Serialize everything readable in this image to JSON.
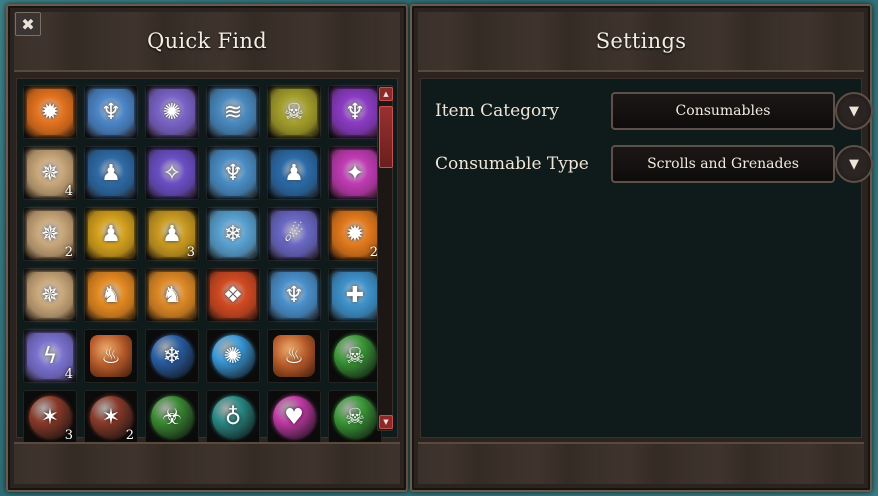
{
  "quick_find": {
    "title": "Quick Find",
    "close_label": "✖",
    "items": [
      {
        "name": "fire-scroll-icon",
        "kind": "scroll",
        "color": "#e5731f",
        "glyph": "✹",
        "count": ""
      },
      {
        "name": "air-scroll-icon",
        "kind": "scroll",
        "color": "#4c86c9",
        "glyph": "♆",
        "count": ""
      },
      {
        "name": "arcane-scroll-icon",
        "kind": "scroll",
        "color": "#7a64c8",
        "glyph": "✺",
        "count": ""
      },
      {
        "name": "rain-scroll-icon",
        "kind": "scroll",
        "color": "#4a8ac0",
        "glyph": "≋",
        "count": ""
      },
      {
        "name": "poison-scroll-icon",
        "kind": "scroll",
        "color": "#a5a02c",
        "glyph": "☠",
        "count": ""
      },
      {
        "name": "shadow-scroll-icon",
        "kind": "scroll",
        "color": "#8c3cc4",
        "glyph": "♆",
        "count": ""
      },
      {
        "name": "blank-scroll-icon",
        "kind": "scroll",
        "color": "#c9a77a",
        "glyph": "✵",
        "count": "4"
      },
      {
        "name": "resist-scroll-icon",
        "kind": "scroll",
        "color": "#2f6aa6",
        "glyph": "♟",
        "count": ""
      },
      {
        "name": "fall-scroll-icon",
        "kind": "scroll",
        "color": "#6a4fc4",
        "glyph": "✧",
        "count": ""
      },
      {
        "name": "levitate-scroll-icon",
        "kind": "scroll",
        "color": "#4a8dc6",
        "glyph": "♆",
        "count": ""
      },
      {
        "name": "ward-scroll-icon",
        "kind": "scroll",
        "color": "#2c6ba8",
        "glyph": "♟",
        "count": ""
      },
      {
        "name": "raven-scroll-icon",
        "kind": "scroll",
        "color": "#c03cb4",
        "glyph": "✦",
        "count": ""
      },
      {
        "name": "blank-scroll-icon",
        "kind": "scroll",
        "color": "#c9a77a",
        "glyph": "✵",
        "count": "2"
      },
      {
        "name": "bless-scroll-icon",
        "kind": "scroll",
        "color": "#d6a21e",
        "glyph": "♟",
        "count": ""
      },
      {
        "name": "strength-scroll-icon",
        "kind": "scroll",
        "color": "#cc9c22",
        "glyph": "♟",
        "count": "3"
      },
      {
        "name": "ice-scroll-icon",
        "kind": "scroll",
        "color": "#5aa2d2",
        "glyph": "❄",
        "count": ""
      },
      {
        "name": "ghost-scroll-icon",
        "kind": "scroll",
        "color": "#6a68c4",
        "glyph": "☄",
        "count": ""
      },
      {
        "name": "fireball-scroll-icon",
        "kind": "scroll",
        "color": "#e47a1c",
        "glyph": "✹",
        "count": "2"
      },
      {
        "name": "blank-scroll-icon",
        "kind": "scroll",
        "color": "#c9a77a",
        "glyph": "✵",
        "count": ""
      },
      {
        "name": "haste-scroll-icon",
        "kind": "scroll",
        "color": "#e58a22",
        "glyph": "♞",
        "count": ""
      },
      {
        "name": "sprint-scroll-icon",
        "kind": "scroll",
        "color": "#e08a26",
        "glyph": "♞",
        "count": ""
      },
      {
        "name": "armor-scroll-icon",
        "kind": "scroll",
        "color": "#d24a22",
        "glyph": "❖",
        "count": ""
      },
      {
        "name": "teleport-scroll-icon",
        "kind": "scroll",
        "color": "#4a90cc",
        "glyph": "♆",
        "count": ""
      },
      {
        "name": "heal-scroll-icon",
        "kind": "scroll",
        "color": "#3f92cc",
        "glyph": "✚",
        "count": ""
      },
      {
        "name": "lightning-scroll-icon",
        "kind": "scroll",
        "color": "#7a72d0",
        "glyph": "ϟ",
        "count": "4"
      },
      {
        "name": "fire-bottle-icon",
        "kind": "bottle",
        "color": "#b65a2a",
        "glyph": "♨",
        "count": ""
      },
      {
        "name": "frost-grenade-icon",
        "kind": "potion",
        "color": "#2a5fa6",
        "glyph": "❄",
        "count": ""
      },
      {
        "name": "water-flask-icon",
        "kind": "potion",
        "color": "#3a9adc",
        "glyph": "✺",
        "count": ""
      },
      {
        "name": "fire-bottle-icon",
        "kind": "bottle",
        "color": "#b65a2a",
        "glyph": "♨",
        "count": ""
      },
      {
        "name": "poison-flask-icon",
        "kind": "potion",
        "color": "#3b9a38",
        "glyph": "☠",
        "count": ""
      },
      {
        "name": "nail-bomb-icon",
        "kind": "potion",
        "color": "#8a3a2a",
        "glyph": "✶",
        "count": "3"
      },
      {
        "name": "nail-bomb-icon",
        "kind": "potion",
        "color": "#8a3a2a",
        "glyph": "✶",
        "count": "2"
      },
      {
        "name": "green-flask-icon",
        "kind": "potion",
        "color": "#3b8a34",
        "glyph": "☣",
        "count": ""
      },
      {
        "name": "water-blessed-flask-icon",
        "kind": "potion",
        "color": "#2a8a86",
        "glyph": "♁",
        "count": ""
      },
      {
        "name": "love-potion-icon",
        "kind": "potion",
        "color": "#c23aa6",
        "glyph": "♥",
        "count": ""
      },
      {
        "name": "poison-flask-icon",
        "kind": "potion",
        "color": "#3b9a38",
        "glyph": "☠",
        "count": ""
      }
    ]
  },
  "settings": {
    "title": "Settings",
    "rows": [
      {
        "label": "Item Category",
        "value": "Consumables"
      },
      {
        "label": "Consumable Type",
        "value": "Scrolls and Grenades"
      }
    ],
    "dropdown_arrow_icon": "chevron-down-icon"
  }
}
